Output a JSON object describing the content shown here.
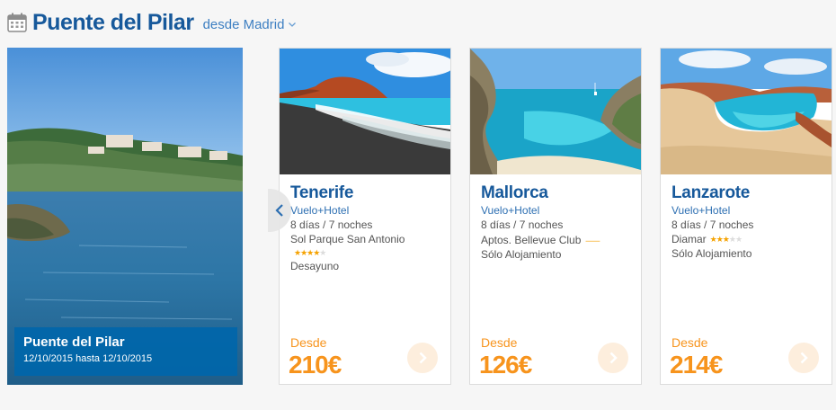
{
  "header": {
    "title": "Puente del Pilar",
    "origin_label": "desde Madrid",
    "icons": {
      "calendar": "calendar-icon",
      "dropdown": "chevron-down-icon"
    }
  },
  "hero": {
    "title": "Puente del Pilar",
    "dates": "12/10/2015 hasta 12/10/2015"
  },
  "cards": [
    {
      "destination": "Tenerife",
      "type": "Vuelo+Hotel",
      "duration": "8 días / 7 noches",
      "hotel": "Sol Parque San Antonio",
      "rating": 4,
      "rating_style": "stars",
      "board": "Desayuno",
      "from_label": "Desde",
      "price": "210€"
    },
    {
      "destination": "Mallorca",
      "type": "Vuelo+Hotel",
      "duration": "8 días / 7 noches",
      "hotel": "Aptos. Bellevue Club",
      "rating": 3,
      "rating_style": "keys",
      "board": "Sólo Alojamiento",
      "from_label": "Desde",
      "price": "126€"
    },
    {
      "destination": "Lanzarote",
      "type": "Vuelo+Hotel",
      "duration": "8 días / 7 noches",
      "hotel": "Diamar",
      "rating": 3,
      "rating_style": "stars",
      "board": "Sólo Alojamiento",
      "from_label": "Desde",
      "price": "214€"
    }
  ],
  "colors": {
    "brand_blue": "#17599b",
    "link_blue": "#2d6fb2",
    "price_orange": "#f7941d",
    "star_orange": "#f5a200"
  }
}
